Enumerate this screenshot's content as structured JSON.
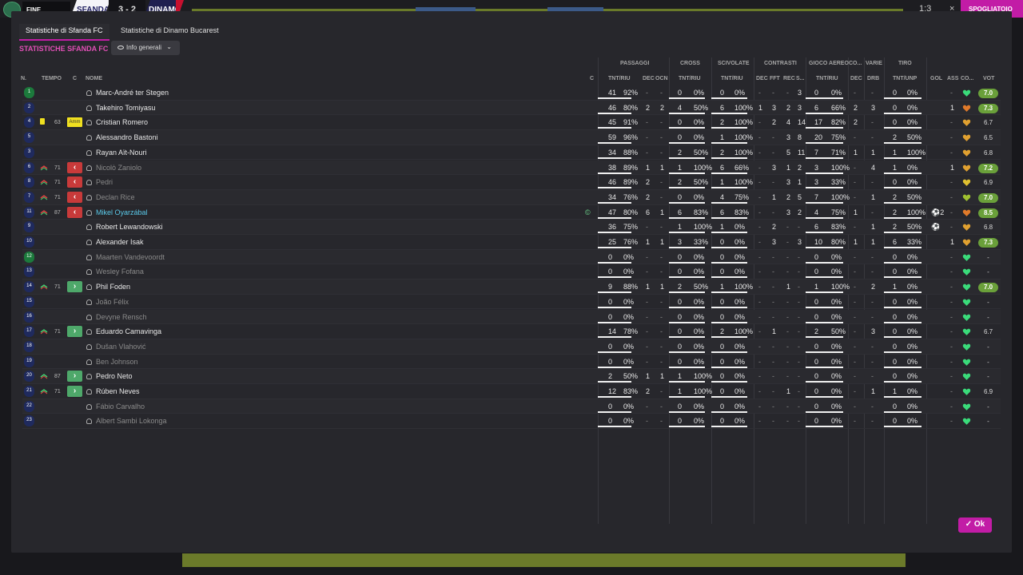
{
  "topbar": {
    "fine_label": "FINE PARTITA",
    "home_team": "SFANDA",
    "score": "3 - 2",
    "away_team": "DINAMO",
    "time": "1:3",
    "close_glyph": "×",
    "action_label": "SPOGLIATOIO"
  },
  "tabs": [
    {
      "label": "Statistiche di Sfanda FC",
      "active": true
    },
    {
      "label": "Statistiche di Dinamo Bucarest",
      "active": false
    }
  ],
  "section_title": "STATISTICHE SFANDA FC",
  "view_dropdown": {
    "value": "Info generali",
    "icon": "eye-icon"
  },
  "ok_label": "Ok",
  "group_headers": {
    "passaggi": "PASSAGGI",
    "cross": "CROSS",
    "scivolate": "SCIVOLATE",
    "contrasti": "CONTRASTI",
    "gioco_aereo": "GIOCO AEREO",
    "co": "CO...",
    "varie": "VARIE",
    "tiro": "TIRO"
  },
  "columns": {
    "n": "N.",
    "tempo": "TEMPO",
    "c": "C",
    "nome": "NOME",
    "c2": "C",
    "pass_tnt": "TNT/RIU",
    "pass_dec": "DEC",
    "pass_ocn": "OCN",
    "cross_tnt": "TNT/RIU",
    "sciv_tnt": "TNT/RIU",
    "con_dec": "DEC",
    "con_fft": "FFT",
    "con_rec": "REC",
    "con_s": "S...",
    "aereo_tnt": "TNT/RIU",
    "co_dec": "DEC",
    "drb": "DRB",
    "tiro_tnt": "TNT/UNP",
    "gol": "GOL",
    "ass": "ASS",
    "co2": "CO...",
    "voto": "VOT"
  },
  "players": [
    {
      "num": "1",
      "gk": true,
      "sub": "",
      "min": "",
      "card": "",
      "box": "",
      "name": "Marc-André ter Stegen",
      "dim": false,
      "hl": false,
      "c": "",
      "p": "41",
      "pp": "92%",
      "pd": "-",
      "po": "-",
      "cr": "0",
      "crp": "0%",
      "sv": "0",
      "svp": "0%",
      "cd": "-",
      "cf": "-",
      "cc": "-",
      "cs": "3",
      "ae": "0",
      "aep": "0%",
      "cod": "-",
      "drb": "-",
      "tr": "0",
      "trp": "0%",
      "gol": "",
      "ass": "-",
      "heart": "#3adb7a",
      "voto": "7.0",
      "vc": "#6aa03a"
    },
    {
      "num": "2",
      "gk": false,
      "sub": "",
      "min": "",
      "card": "",
      "box": "",
      "name": "Takehiro Tomiyasu",
      "dim": false,
      "hl": false,
      "c": "",
      "p": "46",
      "pp": "80%",
      "pd": "2",
      "po": "2",
      "cr": "4",
      "crp": "50%",
      "sv": "6",
      "svp": "100%",
      "cd": "1",
      "cf": "3",
      "cc": "2",
      "cs": "3",
      "ae": "6",
      "aep": "66%",
      "cod": "2",
      "drb": "3",
      "tr": "0",
      "trp": "0%",
      "gol": "",
      "ass": "1",
      "heart": "#e07a2a",
      "voto": "7.3",
      "vc": "#6aa03a"
    },
    {
      "num": "4",
      "gk": false,
      "sub": "",
      "min": "63",
      "card": "yellow",
      "box": "Amm",
      "name": "Cristian Romero",
      "dim": false,
      "hl": false,
      "c": "",
      "p": "45",
      "pp": "91%",
      "pd": "-",
      "po": "-",
      "cr": "0",
      "crp": "0%",
      "sv": "2",
      "svp": "100%",
      "cd": "-",
      "cf": "2",
      "cc": "4",
      "cs": "14",
      "ae": "17",
      "aep": "82%",
      "cod": "2",
      "drb": "-",
      "tr": "0",
      "trp": "0%",
      "gol": "",
      "ass": "-",
      "heart": "#e0a030",
      "voto": "6.7",
      "vc": ""
    },
    {
      "num": "5",
      "gk": false,
      "sub": "",
      "min": "",
      "card": "",
      "box": "",
      "name": "Alessandro Bastoni",
      "dim": false,
      "hl": false,
      "c": "",
      "p": "59",
      "pp": "96%",
      "pd": "-",
      "po": "-",
      "cr": "0",
      "crp": "0%",
      "sv": "1",
      "svp": "100%",
      "cd": "-",
      "cf": "-",
      "cc": "3",
      "cs": "8",
      "ae": "20",
      "aep": "75%",
      "cod": "-",
      "drb": "-",
      "tr": "2",
      "trp": "50%",
      "gol": "",
      "ass": "-",
      "heart": "#e0a030",
      "voto": "6.5",
      "vc": ""
    },
    {
      "num": "3",
      "gk": false,
      "sub": "",
      "min": "",
      "card": "",
      "box": "",
      "name": "Rayan Aït-Nouri",
      "dim": false,
      "hl": false,
      "c": "",
      "p": "34",
      "pp": "88%",
      "pd": "-",
      "po": "-",
      "cr": "2",
      "crp": "50%",
      "sv": "2",
      "svp": "100%",
      "cd": "-",
      "cf": "-",
      "cc": "5",
      "cs": "11",
      "ae": "7",
      "aep": "71%",
      "cod": "1",
      "drb": "1",
      "tr": "1",
      "trp": "100%",
      "gol": "",
      "ass": "-",
      "heart": "#e0a030",
      "voto": "6.8",
      "vc": ""
    },
    {
      "num": "6",
      "gk": false,
      "sub": "off",
      "min": "71",
      "card": "",
      "box": "off",
      "name": "Nicolò Zaniolo",
      "dim": true,
      "hl": false,
      "c": "",
      "p": "38",
      "pp": "89%",
      "pd": "1",
      "po": "1",
      "cr": "1",
      "crp": "100%",
      "sv": "6",
      "svp": "66%",
      "cd": "-",
      "cf": "3",
      "cc": "1",
      "cs": "2",
      "ae": "3",
      "aep": "100%",
      "cod": "-",
      "drb": "4",
      "tr": "1",
      "trp": "0%",
      "gol": "",
      "ass": "1",
      "heart": "#e0a030",
      "voto": "7.2",
      "vc": "#6aa03a"
    },
    {
      "num": "8",
      "gk": false,
      "sub": "off",
      "min": "71",
      "card": "",
      "box": "off",
      "name": "Pedri",
      "dim": true,
      "hl": false,
      "c": "",
      "p": "46",
      "pp": "89%",
      "pd": "2",
      "po": "-",
      "cr": "2",
      "crp": "50%",
      "sv": "1",
      "svp": "100%",
      "cd": "-",
      "cf": "-",
      "cc": "3",
      "cs": "1",
      "ae": "3",
      "aep": "33%",
      "cod": "-",
      "drb": "-",
      "tr": "0",
      "trp": "0%",
      "gol": "",
      "ass": "-",
      "heart": "#e0c030",
      "voto": "6.9",
      "vc": ""
    },
    {
      "num": "7",
      "gk": false,
      "sub": "off",
      "min": "71",
      "card": "",
      "box": "off",
      "name": "Declan Rice",
      "dim": true,
      "hl": false,
      "c": "",
      "p": "34",
      "pp": "76%",
      "pd": "2",
      "po": "-",
      "cr": "0",
      "crp": "0%",
      "sv": "4",
      "svp": "75%",
      "cd": "-",
      "cf": "1",
      "cc": "2",
      "cs": "5",
      "ae": "7",
      "aep": "100%",
      "cod": "-",
      "drb": "1",
      "tr": "2",
      "trp": "50%",
      "gol": "",
      "ass": "-",
      "heart": "#a0c030",
      "voto": "7.0",
      "vc": "#6aa03a"
    },
    {
      "num": "11",
      "gk": false,
      "sub": "off",
      "min": "87",
      "card": "",
      "box": "off",
      "name": "Mikel Oyarzábal",
      "dim": false,
      "hl": true,
      "c": "©",
      "p": "47",
      "pp": "80%",
      "pd": "6",
      "po": "1",
      "cr": "6",
      "crp": "83%",
      "sv": "6",
      "svp": "83%",
      "cd": "-",
      "cf": "-",
      "cc": "3",
      "cs": "2",
      "ae": "4",
      "aep": "75%",
      "cod": "1",
      "drb": "-",
      "tr": "2",
      "trp": "100%",
      "gol": "⚽2",
      "ass": "-",
      "heart": "#e07a2a",
      "voto": "8.5",
      "vc": "#6aa03a"
    },
    {
      "num": "9",
      "gk": false,
      "sub": "",
      "min": "",
      "card": "",
      "box": "",
      "name": "Robert Lewandowski",
      "dim": false,
      "hl": false,
      "c": "",
      "p": "36",
      "pp": "75%",
      "pd": "-",
      "po": "-",
      "cr": "1",
      "crp": "100%",
      "sv": "1",
      "svp": "0%",
      "cd": "-",
      "cf": "2",
      "cc": "-",
      "cs": "-",
      "ae": "6",
      "aep": "83%",
      "cod": "-",
      "drb": "1",
      "tr": "2",
      "trp": "50%",
      "gol": "⚽",
      "ass": "-",
      "heart": "#e0a030",
      "voto": "6.8",
      "vc": ""
    },
    {
      "num": "10",
      "gk": false,
      "sub": "",
      "min": "",
      "card": "",
      "box": "",
      "name": "Alexander Isak",
      "dim": false,
      "hl": false,
      "c": "",
      "p": "25",
      "pp": "76%",
      "pd": "1",
      "po": "1",
      "cr": "3",
      "crp": "33%",
      "sv": "0",
      "svp": "0%",
      "cd": "-",
      "cf": "3",
      "cc": "-",
      "cs": "3",
      "ae": "10",
      "aep": "80%",
      "cod": "1",
      "drb": "1",
      "tr": "6",
      "trp": "33%",
      "gol": "",
      "ass": "1",
      "heart": "#e0a030",
      "voto": "7.3",
      "vc": "#6aa03a"
    },
    {
      "num": "12",
      "gk": true,
      "sub": "",
      "min": "",
      "card": "",
      "box": "",
      "name": "Maarten Vandevoordt",
      "dim": true,
      "hl": false,
      "c": "",
      "p": "0",
      "pp": "0%",
      "pd": "-",
      "po": "-",
      "cr": "0",
      "crp": "0%",
      "sv": "0",
      "svp": "0%",
      "cd": "-",
      "cf": "-",
      "cc": "-",
      "cs": "-",
      "ae": "0",
      "aep": "0%",
      "cod": "-",
      "drb": "-",
      "tr": "0",
      "trp": "0%",
      "gol": "",
      "ass": "-",
      "heart": "#3adb7a",
      "voto": "-",
      "vc": ""
    },
    {
      "num": "13",
      "gk": false,
      "sub": "",
      "min": "",
      "card": "",
      "box": "",
      "name": "Wesley Fofana",
      "dim": true,
      "hl": false,
      "c": "",
      "p": "0",
      "pp": "0%",
      "pd": "-",
      "po": "-",
      "cr": "0",
      "crp": "0%",
      "sv": "0",
      "svp": "0%",
      "cd": "-",
      "cf": "-",
      "cc": "-",
      "cs": "-",
      "ae": "0",
      "aep": "0%",
      "cod": "-",
      "drb": "-",
      "tr": "0",
      "trp": "0%",
      "gol": "",
      "ass": "-",
      "heart": "#3adb7a",
      "voto": "-",
      "vc": ""
    },
    {
      "num": "14",
      "gk": false,
      "sub": "on",
      "min": "71",
      "card": "",
      "box": "on",
      "name": "Phil Foden",
      "dim": false,
      "hl": false,
      "c": "",
      "p": "9",
      "pp": "88%",
      "pd": "1",
      "po": "1",
      "cr": "2",
      "crp": "50%",
      "sv": "1",
      "svp": "100%",
      "cd": "-",
      "cf": "-",
      "cc": "1",
      "cs": "-",
      "ae": "1",
      "aep": "100%",
      "cod": "-",
      "drb": "2",
      "tr": "1",
      "trp": "0%",
      "gol": "",
      "ass": "-",
      "heart": "#3adb7a",
      "voto": "7.0",
      "vc": "#6aa03a"
    },
    {
      "num": "15",
      "gk": false,
      "sub": "",
      "min": "",
      "card": "",
      "box": "",
      "name": "João Félix",
      "dim": true,
      "hl": false,
      "c": "",
      "p": "0",
      "pp": "0%",
      "pd": "-",
      "po": "-",
      "cr": "0",
      "crp": "0%",
      "sv": "0",
      "svp": "0%",
      "cd": "-",
      "cf": "-",
      "cc": "-",
      "cs": "-",
      "ae": "0",
      "aep": "0%",
      "cod": "-",
      "drb": "-",
      "tr": "0",
      "trp": "0%",
      "gol": "",
      "ass": "-",
      "heart": "#3adb7a",
      "voto": "-",
      "vc": ""
    },
    {
      "num": "16",
      "gk": false,
      "sub": "",
      "min": "",
      "card": "",
      "box": "",
      "name": "Devyne Rensch",
      "dim": true,
      "hl": false,
      "c": "",
      "p": "0",
      "pp": "0%",
      "pd": "-",
      "po": "-",
      "cr": "0",
      "crp": "0%",
      "sv": "0",
      "svp": "0%",
      "cd": "-",
      "cf": "-",
      "cc": "-",
      "cs": "-",
      "ae": "0",
      "aep": "0%",
      "cod": "-",
      "drb": "-",
      "tr": "0",
      "trp": "0%",
      "gol": "",
      "ass": "-",
      "heart": "#3adb7a",
      "voto": "-",
      "vc": ""
    },
    {
      "num": "17",
      "gk": false,
      "sub": "on",
      "min": "71",
      "card": "",
      "box": "on",
      "name": "Eduardo Camavinga",
      "dim": false,
      "hl": false,
      "c": "",
      "p": "14",
      "pp": "78%",
      "pd": "-",
      "po": "-",
      "cr": "0",
      "crp": "0%",
      "sv": "2",
      "svp": "100%",
      "cd": "-",
      "cf": "1",
      "cc": "-",
      "cs": "-",
      "ae": "2",
      "aep": "50%",
      "cod": "-",
      "drb": "3",
      "tr": "0",
      "trp": "0%",
      "gol": "",
      "ass": "-",
      "heart": "#3adb7a",
      "voto": "6.7",
      "vc": ""
    },
    {
      "num": "18",
      "gk": false,
      "sub": "",
      "min": "",
      "card": "",
      "box": "",
      "name": "Dušan Vlahović",
      "dim": true,
      "hl": false,
      "c": "",
      "p": "0",
      "pp": "0%",
      "pd": "-",
      "po": "-",
      "cr": "0",
      "crp": "0%",
      "sv": "0",
      "svp": "0%",
      "cd": "-",
      "cf": "-",
      "cc": "-",
      "cs": "-",
      "ae": "0",
      "aep": "0%",
      "cod": "-",
      "drb": "-",
      "tr": "0",
      "trp": "0%",
      "gol": "",
      "ass": "-",
      "heart": "#3adb7a",
      "voto": "-",
      "vc": ""
    },
    {
      "num": "19",
      "gk": false,
      "sub": "",
      "min": "",
      "card": "",
      "box": "",
      "name": "Ben Johnson",
      "dim": true,
      "hl": false,
      "c": "",
      "p": "0",
      "pp": "0%",
      "pd": "-",
      "po": "-",
      "cr": "0",
      "crp": "0%",
      "sv": "0",
      "svp": "0%",
      "cd": "-",
      "cf": "-",
      "cc": "-",
      "cs": "-",
      "ae": "0",
      "aep": "0%",
      "cod": "-",
      "drb": "-",
      "tr": "0",
      "trp": "0%",
      "gol": "",
      "ass": "-",
      "heart": "#3adb7a",
      "voto": "-",
      "vc": ""
    },
    {
      "num": "20",
      "gk": false,
      "sub": "on",
      "min": "87",
      "card": "",
      "box": "on",
      "name": "Pedro Neto",
      "dim": false,
      "hl": false,
      "c": "",
      "p": "2",
      "pp": "50%",
      "pd": "1",
      "po": "1",
      "cr": "1",
      "crp": "100%",
      "sv": "0",
      "svp": "0%",
      "cd": "-",
      "cf": "-",
      "cc": "-",
      "cs": "-",
      "ae": "0",
      "aep": "0%",
      "cod": "-",
      "drb": "-",
      "tr": "0",
      "trp": "0%",
      "gol": "",
      "ass": "-",
      "heart": "#3adb7a",
      "voto": "-",
      "vc": ""
    },
    {
      "num": "21",
      "gk": false,
      "sub": "on",
      "min": "71",
      "card": "",
      "box": "on",
      "name": "Rúben Neves",
      "dim": false,
      "hl": false,
      "c": "",
      "p": "12",
      "pp": "83%",
      "pd": "2",
      "po": "-",
      "cr": "1",
      "crp": "100%",
      "sv": "0",
      "svp": "0%",
      "cd": "-",
      "cf": "-",
      "cc": "1",
      "cs": "-",
      "ae": "0",
      "aep": "0%",
      "cod": "-",
      "drb": "1",
      "tr": "1",
      "trp": "0%",
      "gol": "",
      "ass": "-",
      "heart": "#3adb7a",
      "voto": "6.9",
      "vc": ""
    },
    {
      "num": "22",
      "gk": false,
      "sub": "",
      "min": "",
      "card": "",
      "box": "",
      "name": "Fábio Carvalho",
      "dim": true,
      "hl": false,
      "c": "",
      "p": "0",
      "pp": "0%",
      "pd": "-",
      "po": "-",
      "cr": "0",
      "crp": "0%",
      "sv": "0",
      "svp": "0%",
      "cd": "-",
      "cf": "-",
      "cc": "-",
      "cs": "-",
      "ae": "0",
      "aep": "0%",
      "cod": "-",
      "drb": "-",
      "tr": "0",
      "trp": "0%",
      "gol": "",
      "ass": "-",
      "heart": "#3adb7a",
      "voto": "-",
      "vc": ""
    },
    {
      "num": "23",
      "gk": false,
      "sub": "",
      "min": "",
      "card": "",
      "box": "",
      "name": "Albert Sambi Lokonga",
      "dim": true,
      "hl": false,
      "c": "",
      "p": "0",
      "pp": "0%",
      "pd": "-",
      "po": "-",
      "cr": "0",
      "crp": "0%",
      "sv": "0",
      "svp": "0%",
      "cd": "-",
      "cf": "-",
      "cc": "-",
      "cs": "-",
      "ae": "0",
      "aep": "0%",
      "cod": "-",
      "drb": "-",
      "tr": "0",
      "trp": "0%",
      "gol": "",
      "ass": "-",
      "heart": "#3adb7a",
      "voto": "-",
      "vc": ""
    }
  ]
}
